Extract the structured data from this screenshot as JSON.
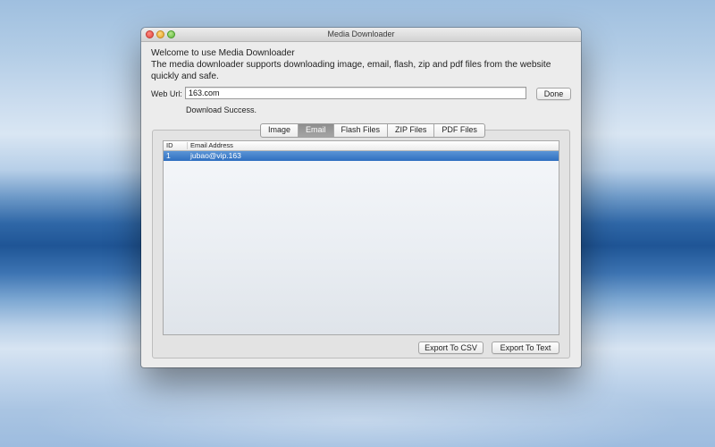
{
  "window": {
    "title": "Media Downloader"
  },
  "intro": {
    "line1": "Welcome to use Media Downloader",
    "line2": "The media downloader supports downloading image, email, flash, zip and pdf files from the website",
    "line3": "quickly and safe."
  },
  "url": {
    "label": "Web Url:",
    "value": "163.com"
  },
  "done_button": "Done",
  "status": "Download Success.",
  "tabs": [
    {
      "label": "Image",
      "active": false
    },
    {
      "label": "Email",
      "active": true
    },
    {
      "label": "Flash Files",
      "active": false
    },
    {
      "label": "ZIP Files",
      "active": false
    },
    {
      "label": "PDF Files",
      "active": false
    }
  ],
  "table": {
    "columns": [
      "ID",
      "Email Address"
    ],
    "rows": [
      {
        "id": "1",
        "email": "jubao@vip.163",
        "selected": true
      }
    ]
  },
  "buttons": {
    "export_csv": "Export To CSV",
    "export_text": "Export To Text"
  },
  "colors": {
    "selection": "#3a7bc8",
    "active_tab": "#979797"
  }
}
